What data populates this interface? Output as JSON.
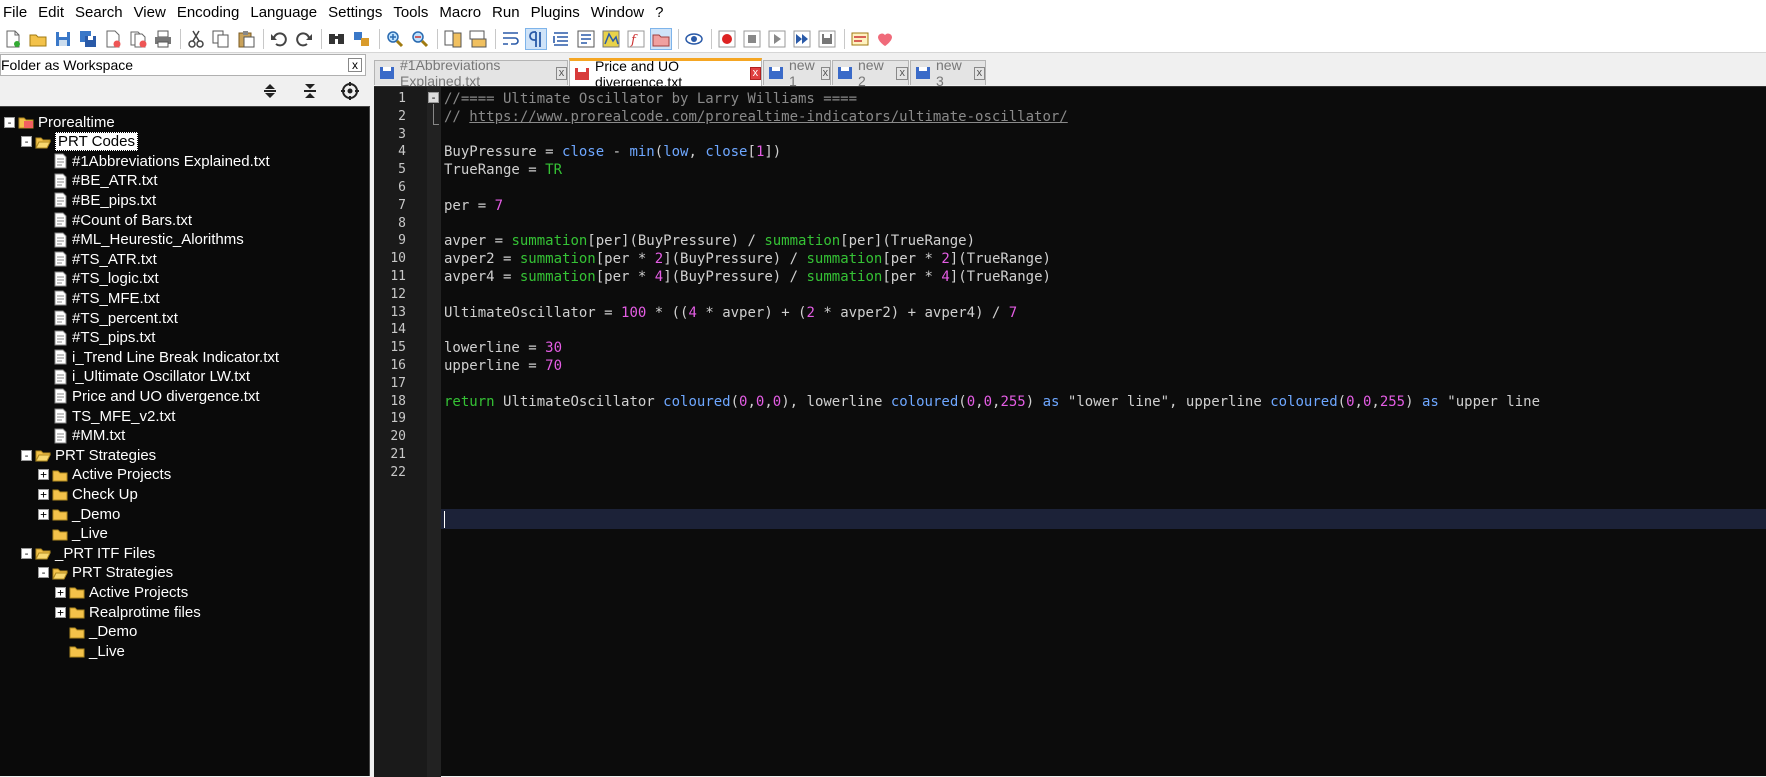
{
  "menu": [
    "File",
    "Edit",
    "Search",
    "View",
    "Encoding",
    "Language",
    "Settings",
    "Tools",
    "Macro",
    "Run",
    "Plugins",
    "Window",
    "?"
  ],
  "toolbar_icons": [
    "new-file-icon",
    "open-file-icon",
    "save-icon",
    "save-all-icon",
    "close-icon",
    "close-all-icon",
    "print-icon",
    "cut-icon",
    "copy-icon",
    "paste-icon",
    "undo-icon",
    "redo-icon",
    "find-icon",
    "replace-icon",
    "zoom-in-icon",
    "zoom-out-icon",
    "sync-vertical-icon",
    "sync-horizontal-icon",
    "word-wrap-icon",
    "show-all-chars-icon",
    "indent-guide-icon",
    "user-lang-icon",
    "doc-map-icon",
    "function-list-icon",
    "folder-workspace-icon",
    "monitoring-icon",
    "record-macro-icon",
    "stop-macro-icon",
    "play-macro-icon",
    "run-macro-multiple-icon",
    "save-macro-icon",
    "spellcheck-icon",
    "heart-icon"
  ],
  "panel": {
    "title": "Folder as Workspace",
    "close": "x"
  },
  "tree": [
    {
      "label": "Prorealtime",
      "depth": 0,
      "type": "root",
      "exp": "-"
    },
    {
      "label": "PRT Codes",
      "depth": 1,
      "type": "folder",
      "exp": "-",
      "selected": true
    },
    {
      "label": "#1Abbreviations Explained.txt",
      "depth": 2,
      "type": "file"
    },
    {
      "label": "#BE_ATR.txt",
      "depth": 2,
      "type": "file"
    },
    {
      "label": "#BE_pips.txt",
      "depth": 2,
      "type": "file"
    },
    {
      "label": "#Count of Bars.txt",
      "depth": 2,
      "type": "file"
    },
    {
      "label": "#ML_Heurestic_Alorithms",
      "depth": 2,
      "type": "file"
    },
    {
      "label": "#TS_ATR.txt",
      "depth": 2,
      "type": "file"
    },
    {
      "label": "#TS_logic.txt",
      "depth": 2,
      "type": "file"
    },
    {
      "label": "#TS_MFE.txt",
      "depth": 2,
      "type": "file"
    },
    {
      "label": "#TS_percent.txt",
      "depth": 2,
      "type": "file"
    },
    {
      "label": "#TS_pips.txt",
      "depth": 2,
      "type": "file"
    },
    {
      "label": "i_Trend Line Break Indicator.txt",
      "depth": 2,
      "type": "file"
    },
    {
      "label": "i_Ultimate Oscillator LW.txt",
      "depth": 2,
      "type": "file"
    },
    {
      "label": "Price and UO divergence.txt",
      "depth": 2,
      "type": "file"
    },
    {
      "label": "TS_MFE_v2.txt",
      "depth": 2,
      "type": "file"
    },
    {
      "label": "#MM.txt",
      "depth": 2,
      "type": "file"
    },
    {
      "label": "PRT Strategies",
      "depth": 1,
      "type": "folder",
      "exp": "-"
    },
    {
      "label": "Active Projects",
      "depth": 2,
      "type": "folder",
      "exp": "+"
    },
    {
      "label": "Check Up",
      "depth": 2,
      "type": "folder",
      "exp": "+"
    },
    {
      "label": "_Demo",
      "depth": 2,
      "type": "folder",
      "exp": "+"
    },
    {
      "label": "_Live",
      "depth": 2,
      "type": "folder"
    },
    {
      "label": "_PRT ITF Files",
      "depth": 1,
      "type": "folder",
      "exp": "-"
    },
    {
      "label": "PRT Strategies",
      "depth": 2,
      "type": "folder",
      "exp": "-"
    },
    {
      "label": "Active Projects",
      "depth": 3,
      "type": "folder",
      "exp": "+"
    },
    {
      "label": "Realprotime files",
      "depth": 3,
      "type": "folder",
      "exp": "+"
    },
    {
      "label": "_Demo",
      "depth": 3,
      "type": "folder"
    },
    {
      "label": "_Live",
      "depth": 3,
      "type": "folder"
    }
  ],
  "tabs": [
    {
      "label": "#1Abbreviations Explained.txt",
      "active": false,
      "icon": "saved-file-icon"
    },
    {
      "label": "Price and UO divergence.txt",
      "active": true,
      "icon": "unsaved-file-icon"
    },
    {
      "label": "new 1",
      "active": false,
      "icon": "saved-file-icon"
    },
    {
      "label": "new 2",
      "active": false,
      "icon": "saved-file-icon"
    },
    {
      "label": "new 3",
      "active": false,
      "icon": "saved-file-icon"
    }
  ],
  "tab_close": "x",
  "code_lines": [
    [
      [
        "c-com",
        "//==== Ultimate Oscillator by Larry Williams ===="
      ]
    ],
    [
      [
        "c-com",
        "// "
      ],
      [
        "c-url",
        "https://www.prorealcode.com/prorealtime-indicators/ultimate-oscillator/"
      ]
    ],
    [],
    [
      [
        "c-id",
        "BuyPressure "
      ],
      [
        "c-op",
        "= "
      ],
      [
        "c-kw",
        "close "
      ],
      [
        "c-op",
        "- "
      ],
      [
        "c-kw",
        "min"
      ],
      [
        "c-op",
        "("
      ],
      [
        "c-kw",
        "low"
      ],
      [
        "c-op",
        ", "
      ],
      [
        "c-kw",
        "close"
      ],
      [
        "c-op",
        "["
      ],
      [
        "c-num",
        "1"
      ],
      [
        "c-op",
        "])"
      ]
    ],
    [
      [
        "c-id",
        "TrueRange "
      ],
      [
        "c-op",
        "= "
      ],
      [
        "c-fn",
        "TR"
      ]
    ],
    [],
    [
      [
        "c-id",
        "per "
      ],
      [
        "c-op",
        "= "
      ],
      [
        "c-num",
        "7"
      ]
    ],
    [],
    [
      [
        "c-id",
        "avper "
      ],
      [
        "c-op",
        "= "
      ],
      [
        "c-fn",
        "summation"
      ],
      [
        "c-op",
        "[per]("
      ],
      [
        "c-id",
        "BuyPressure"
      ],
      [
        "c-op",
        ") / "
      ],
      [
        "c-fn",
        "summation"
      ],
      [
        "c-op",
        "[per]("
      ],
      [
        "c-id",
        "TrueRange"
      ],
      [
        "c-op",
        ")"
      ]
    ],
    [
      [
        "c-id",
        "avper2 "
      ],
      [
        "c-op",
        "= "
      ],
      [
        "c-fn",
        "summation"
      ],
      [
        "c-op",
        "[per * "
      ],
      [
        "c-num",
        "2"
      ],
      [
        "c-op",
        "]("
      ],
      [
        "c-id",
        "BuyPressure"
      ],
      [
        "c-op",
        ") / "
      ],
      [
        "c-fn",
        "summation"
      ],
      [
        "c-op",
        "[per * "
      ],
      [
        "c-num",
        "2"
      ],
      [
        "c-op",
        "]("
      ],
      [
        "c-id",
        "TrueRange"
      ],
      [
        "c-op",
        ")"
      ]
    ],
    [
      [
        "c-id",
        "avper4 "
      ],
      [
        "c-op",
        "= "
      ],
      [
        "c-fn",
        "summation"
      ],
      [
        "c-op",
        "[per * "
      ],
      [
        "c-num",
        "4"
      ],
      [
        "c-op",
        "]("
      ],
      [
        "c-id",
        "BuyPressure"
      ],
      [
        "c-op",
        ") / "
      ],
      [
        "c-fn",
        "summation"
      ],
      [
        "c-op",
        "[per * "
      ],
      [
        "c-num",
        "4"
      ],
      [
        "c-op",
        "]("
      ],
      [
        "c-id",
        "TrueRange"
      ],
      [
        "c-op",
        ")"
      ]
    ],
    [],
    [
      [
        "c-id",
        "UltimateOscillator "
      ],
      [
        "c-op",
        "= "
      ],
      [
        "c-num",
        "100"
      ],
      [
        "c-op",
        " * (("
      ],
      [
        "c-num",
        "4"
      ],
      [
        "c-op",
        " * avper) + ("
      ],
      [
        "c-num",
        "2"
      ],
      [
        "c-op",
        " * avper2) + avper4) / "
      ],
      [
        "c-num",
        "7"
      ]
    ],
    [],
    [
      [
        "c-id",
        "lowerline "
      ],
      [
        "c-op",
        "= "
      ],
      [
        "c-num",
        "30"
      ]
    ],
    [
      [
        "c-id",
        "upperline "
      ],
      [
        "c-op",
        "= "
      ],
      [
        "c-num",
        "70"
      ]
    ],
    [],
    [
      [
        "c-fn",
        "return "
      ],
      [
        "c-id",
        "UltimateOscillator "
      ],
      [
        "c-kw",
        "coloured"
      ],
      [
        "c-op",
        "("
      ],
      [
        "c-num",
        "0"
      ],
      [
        "c-op",
        ","
      ],
      [
        "c-num",
        "0"
      ],
      [
        "c-op",
        ","
      ],
      [
        "c-num",
        "0"
      ],
      [
        "c-op",
        "), lowerline "
      ],
      [
        "c-kw",
        "coloured"
      ],
      [
        "c-op",
        "("
      ],
      [
        "c-num",
        "0"
      ],
      [
        "c-op",
        ","
      ],
      [
        "c-num",
        "0"
      ],
      [
        "c-op",
        ","
      ],
      [
        "c-num",
        "255"
      ],
      [
        "c-op",
        ") "
      ],
      [
        "c-kw",
        "as "
      ],
      [
        "c-str",
        "\"lower line\""
      ],
      [
        "c-op",
        ", upperline "
      ],
      [
        "c-kw",
        "coloured"
      ],
      [
        "c-op",
        "("
      ],
      [
        "c-num",
        "0"
      ],
      [
        "c-op",
        ","
      ],
      [
        "c-num",
        "0"
      ],
      [
        "c-op",
        ","
      ],
      [
        "c-num",
        "255"
      ],
      [
        "c-op",
        ") "
      ],
      [
        "c-kw",
        "as "
      ],
      [
        "c-str",
        "\"upper line"
      ]
    ],
    [],
    [],
    [],
    []
  ],
  "line_numbers": [
    "1",
    "2",
    "3",
    "4",
    "5",
    "6",
    "7",
    "8",
    "9",
    "10",
    "11",
    "12",
    "13",
    "14",
    "15",
    "16",
    "17",
    "18",
    "19",
    "20",
    "21",
    "22"
  ],
  "fold_marker": "-",
  "colors": {
    "accent_tab": "#f5a623",
    "editor_bg": "#0c0c0c",
    "keyword": "#6ea7ff",
    "function": "#35c235",
    "number": "#e45de4",
    "comment": "#8a8a8a"
  }
}
